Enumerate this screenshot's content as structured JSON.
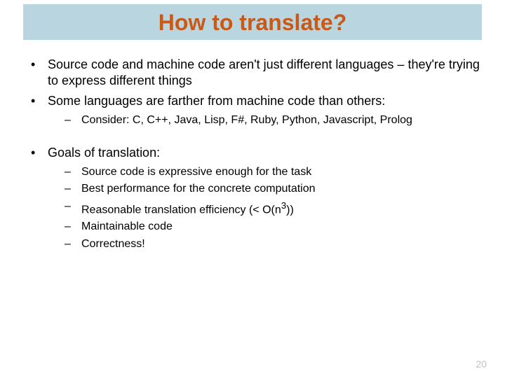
{
  "title": "How to translate?",
  "bullets": {
    "b1": "Source code and machine code aren't just different languages – they're trying to express different things",
    "b2": "Some languages are farther from machine code than others:",
    "b2_sub1": "Consider: C, C++, Java, Lisp, F#, Ruby, Python, Javascript, Prolog",
    "b3": "Goals of translation:",
    "b3_sub1": "Source code is expressive enough for the task",
    "b3_sub2": "Best performance for the concrete computation",
    "b3_sub3_pre": "Reasonable translation efficiency (< O(n",
    "b3_sub3_sup": "3",
    "b3_sub3_post": "))",
    "b3_sub4": "Maintainable code",
    "b3_sub5": "Correctness!"
  },
  "page_number": "20"
}
